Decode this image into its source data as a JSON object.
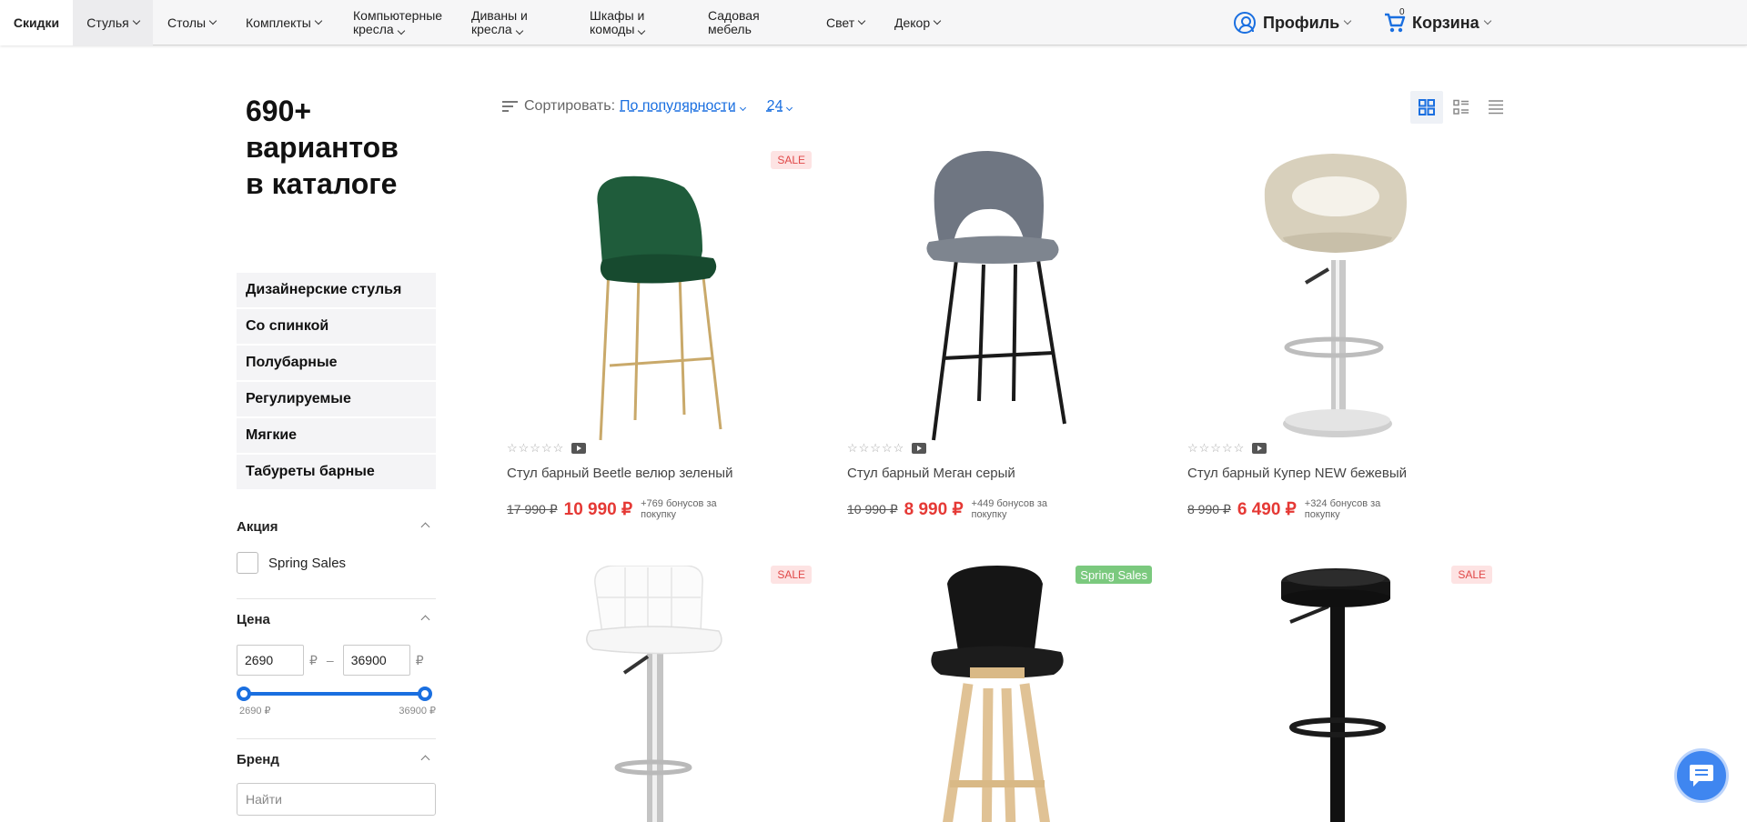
{
  "nav": {
    "items": [
      {
        "label": "Скидки"
      },
      {
        "label": "Стулья"
      },
      {
        "label": "Столы"
      },
      {
        "label": "Комплекты"
      },
      {
        "label": "Компьютерные кресла"
      },
      {
        "label": "Диваны и кресла"
      },
      {
        "label": "Шкафы и комоды"
      },
      {
        "label": "Садовая мебель"
      },
      {
        "label": "Свет"
      },
      {
        "label": "Декор"
      }
    ],
    "profile_label": "Профиль",
    "cart_label": "Корзина",
    "cart_count": "0"
  },
  "catalog": {
    "count_line1": "690+",
    "count_line2": "вариантов",
    "count_line3": "в каталоге"
  },
  "categories": [
    {
      "label": "Дизайнерские стулья"
    },
    {
      "label": "Со спинкой"
    },
    {
      "label": "Полубарные"
    },
    {
      "label": "Регулируемые"
    },
    {
      "label": "Мягкие"
    },
    {
      "label": "Табуреты барные"
    }
  ],
  "filters": {
    "promo": {
      "title": "Акция",
      "option": "Spring Sales"
    },
    "price": {
      "title": "Цена",
      "min_value": "2690",
      "max_value": "36900",
      "currency": "₽",
      "min_label": "2690 ₽",
      "max_label": "36900 ₽",
      "range_min": 2690,
      "range_max": 36900
    },
    "brand": {
      "title": "Бренд",
      "placeholder": "Найти"
    }
  },
  "toolbar": {
    "sort_label": "Сортировать:",
    "sort_value": "По популярности",
    "per_page": "24",
    "views": [
      "grid-view-icon",
      "list-grid-view-icon",
      "list-view-icon"
    ]
  },
  "products": [
    {
      "name": "Стул барный Beetle велюр зеленый",
      "old_price": "17 990 ₽",
      "price": "10 990 ₽",
      "bonus": "+769 бонусов за покупку",
      "badge": "SALE",
      "color": "#1e5c3a"
    },
    {
      "name": "Стул барный Меган серый",
      "old_price": "10 990 ₽",
      "price": "8 990 ₽",
      "bonus": "+449 бонусов за покупку",
      "badge": "",
      "color": "#6e7580"
    },
    {
      "name": "Стул барный Купер NEW бежевый",
      "old_price": "8 990 ₽",
      "price": "6 490 ₽",
      "bonus": "+324 бонусов за покупку",
      "badge": "",
      "color": "#d6cdb8"
    },
    {
      "name": "",
      "old_price": "",
      "price": "",
      "bonus": "",
      "badge": "SALE",
      "color": "#f4f4f4"
    },
    {
      "name": "",
      "old_price": "",
      "price": "",
      "bonus": "",
      "badge": "Spring Sales",
      "color": "#151515"
    },
    {
      "name": "",
      "old_price": "",
      "price": "",
      "bonus": "",
      "badge": "SALE",
      "color": "#151515"
    }
  ],
  "colors": {
    "accent": "#1a6fe0",
    "sale_price": "#e53935",
    "sale_badge_bg": "#fde3e3",
    "spring_badge_bg": "#7bc97e"
  }
}
